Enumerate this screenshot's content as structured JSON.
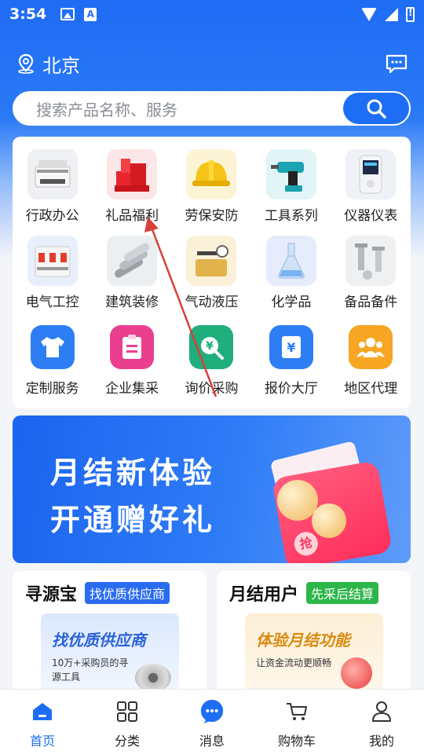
{
  "status_bar": {
    "time": "3:54",
    "sb_a": "A"
  },
  "header": {
    "city": "北京"
  },
  "search": {
    "placeholder": "搜索产品名称、服务"
  },
  "categories": [
    {
      "label": "行政办公",
      "icon": "printer-icon"
    },
    {
      "label": "礼品福利",
      "icon": "gift-icon"
    },
    {
      "label": "劳保安防",
      "icon": "helmet-icon"
    },
    {
      "label": "工具系列",
      "icon": "drill-icon"
    },
    {
      "label": "仪器仪表",
      "icon": "meter-icon"
    },
    {
      "label": "电气工控",
      "icon": "breaker-icon"
    },
    {
      "label": "建筑装修",
      "icon": "pipes-icon"
    },
    {
      "label": "气动液压",
      "icon": "hydraulic-icon"
    },
    {
      "label": "化学品",
      "icon": "flask-icon"
    },
    {
      "label": "备品备件",
      "icon": "screws-icon"
    },
    {
      "label": "定制服务",
      "icon": "tshirt-icon"
    },
    {
      "label": "企业集采",
      "icon": "clipboard-icon"
    },
    {
      "label": "询价采购",
      "icon": "price-search-icon"
    },
    {
      "label": "报价大厅",
      "icon": "quote-icon"
    },
    {
      "label": "地区代理",
      "icon": "group-icon"
    }
  ],
  "banner": {
    "line1": "月结新体验",
    "line2": "开通赠好礼",
    "envelope_text": "抢"
  },
  "promos": [
    {
      "title": "寻源宝",
      "tag": "找优质供应商",
      "card_title": "找优质供应商",
      "card_desc": "10万+采购员的寻源工具",
      "tag_color": "#2a6cf0"
    },
    {
      "title": "月结用户",
      "tag": "先采后结算",
      "card_title": "体验月结功能",
      "card_desc": "让资金流动更顺畅",
      "tag_color": "#2db54a"
    }
  ],
  "tabbar": [
    {
      "label": "首页",
      "icon": "home-icon",
      "active": true
    },
    {
      "label": "分类",
      "icon": "grid-icon",
      "active": false
    },
    {
      "label": "消息",
      "icon": "message-icon",
      "active": false
    },
    {
      "label": "购物车",
      "icon": "cart-icon",
      "active": false
    },
    {
      "label": "我的",
      "icon": "profile-icon",
      "active": false
    }
  ],
  "colors": {
    "primary": "#1e6ef5",
    "annotation_arrow": "#d9403a"
  }
}
